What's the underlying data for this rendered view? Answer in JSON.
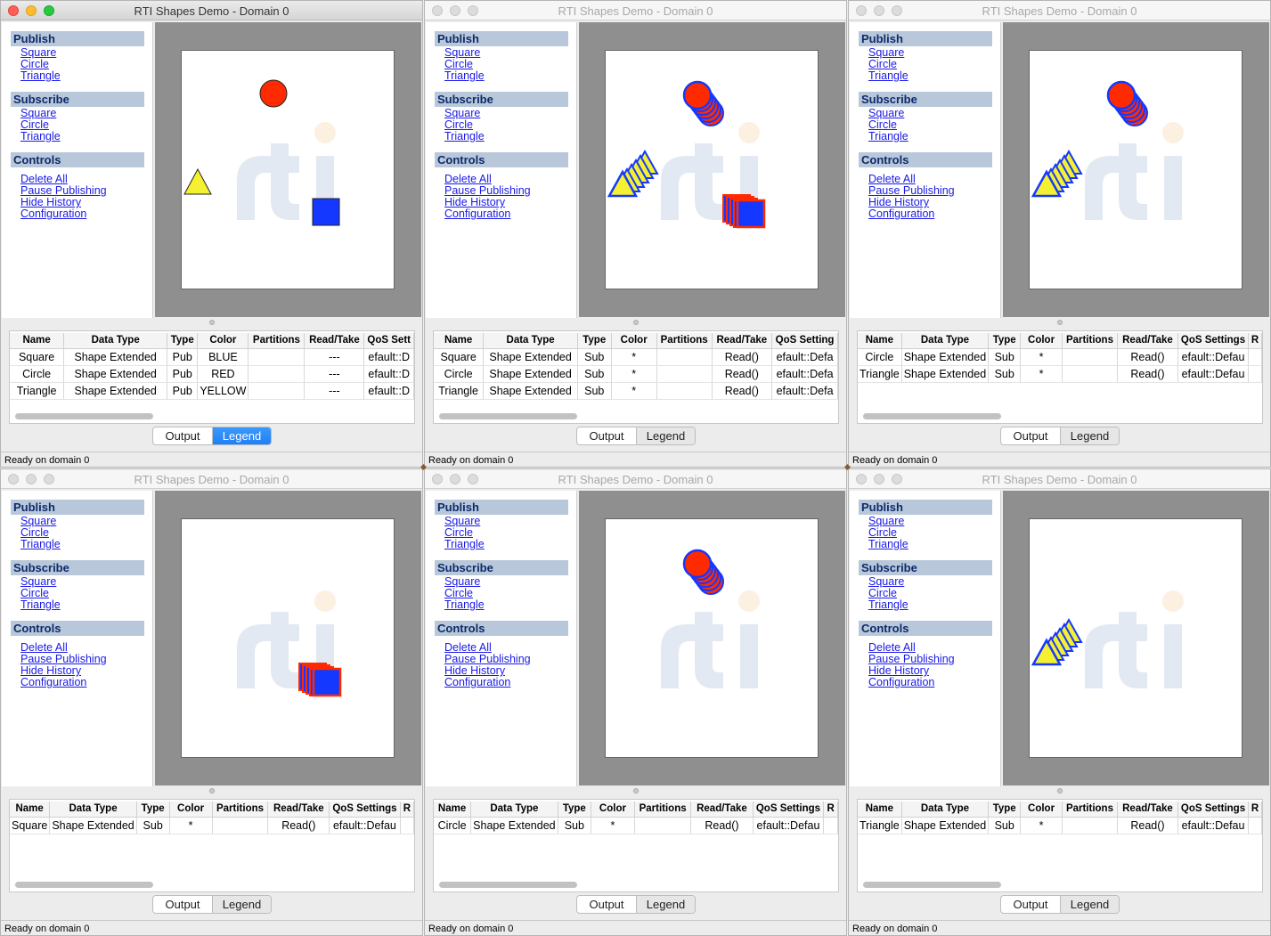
{
  "colors": {
    "accent": "#1f7ff7",
    "shape_red": "#ff2a00",
    "shape_blue": "#1438ff",
    "shape_yellow": "#f5f032",
    "section_header": "#b8c8da",
    "link": "#1a1ae6"
  },
  "windows": [
    {
      "title": "RTI Shapes Demo - Domain 0",
      "active": true,
      "sections": [
        {
          "label": "Publish",
          "links": [
            "Square",
            "Circle",
            "Triangle"
          ]
        },
        {
          "label": "Subscribe",
          "links": [
            "Square",
            "Circle",
            "Triangle"
          ]
        },
        {
          "label": "Controls",
          "links": [
            "Delete All",
            "Pause Publishing",
            "Hide History",
            "Configuration"
          ]
        }
      ],
      "table": {
        "columns": [
          "Name",
          "Data Type",
          "Type",
          "Color",
          "Partitions",
          "Read/Take",
          "QoS Sett"
        ],
        "rows": [
          [
            "Square",
            "Shape Extended",
            "Pub",
            "BLUE",
            "",
            "---",
            "efault::D"
          ],
          [
            "Circle",
            "Shape Extended",
            "Pub",
            "RED",
            "",
            "---",
            "efault::D"
          ],
          [
            "Triangle",
            "Shape Extended",
            "Pub",
            "YELLOW",
            "",
            "---",
            "efault::D"
          ]
        ]
      },
      "tabs": [
        "Output",
        "Legend"
      ],
      "selected_tab": "Legend",
      "status": "Ready on domain 0"
    },
    {
      "title": "RTI Shapes Demo - Domain 0",
      "active": false,
      "sections": [
        {
          "label": "Publish",
          "links": [
            "Square",
            "Circle",
            "Triangle"
          ]
        },
        {
          "label": "Subscribe",
          "links": [
            "Square",
            "Circle",
            "Triangle"
          ]
        },
        {
          "label": "Controls",
          "links": [
            "Delete All",
            "Pause Publishing",
            "Hide History",
            "Configuration"
          ]
        }
      ],
      "table": {
        "columns": [
          "Name",
          "Data Type",
          "Type",
          "Color",
          "Partitions",
          "Read/Take",
          "QoS Setting"
        ],
        "rows": [
          [
            "Square",
            "Shape Extended",
            "Sub",
            "*",
            "",
            "Read()",
            "efault::Defa"
          ],
          [
            "Circle",
            "Shape Extended",
            "Sub",
            "*",
            "",
            "Read()",
            "efault::Defa"
          ],
          [
            "Triangle",
            "Shape Extended",
            "Sub",
            "*",
            "",
            "Read()",
            "efault::Defa"
          ]
        ]
      },
      "tabs": [
        "Output",
        "Legend"
      ],
      "selected_tab": "",
      "status": "Ready on domain 0"
    },
    {
      "title": "RTI Shapes Demo - Domain 0",
      "active": false,
      "sections": [
        {
          "label": "Publish",
          "links": [
            "Square",
            "Circle",
            "Triangle"
          ]
        },
        {
          "label": "Subscribe",
          "links": [
            "Square",
            "Circle",
            "Triangle"
          ]
        },
        {
          "label": "Controls",
          "links": [
            "Delete All",
            "Pause Publishing",
            "Hide History",
            "Configuration"
          ]
        }
      ],
      "table": {
        "columns": [
          "Name",
          "Data Type",
          "Type",
          "Color",
          "Partitions",
          "Read/Take",
          "QoS Settings",
          "R"
        ],
        "rows": [
          [
            "Circle",
            "Shape Extended",
            "Sub",
            "*",
            "",
            "Read()",
            "efault::Defau",
            ""
          ],
          [
            "Triangle",
            "Shape Extended",
            "Sub",
            "*",
            "",
            "Read()",
            "efault::Defau",
            ""
          ]
        ]
      },
      "tabs": [
        "Output",
        "Legend"
      ],
      "selected_tab": "",
      "status": "Ready on domain 0"
    },
    {
      "title": "RTI Shapes Demo - Domain 0",
      "active": false,
      "sections": [
        {
          "label": "Publish",
          "links": [
            "Square",
            "Circle",
            "Triangle"
          ]
        },
        {
          "label": "Subscribe",
          "links": [
            "Square",
            "Circle",
            "Triangle"
          ]
        },
        {
          "label": "Controls",
          "links": [
            "Delete All",
            "Pause Publishing",
            "Hide History",
            "Configuration"
          ]
        }
      ],
      "table": {
        "columns": [
          "Name",
          "Data Type",
          "Type",
          "Color",
          "Partitions",
          "Read/Take",
          "QoS Settings",
          "R"
        ],
        "rows": [
          [
            "Square",
            "Shape Extended",
            "Sub",
            "*",
            "",
            "Read()",
            "efault::Defau",
            ""
          ]
        ]
      },
      "tabs": [
        "Output",
        "Legend"
      ],
      "selected_tab": "",
      "status": "Ready on domain 0"
    },
    {
      "title": "RTI Shapes Demo - Domain 0",
      "active": false,
      "sections": [
        {
          "label": "Publish",
          "links": [
            "Square",
            "Circle",
            "Triangle"
          ]
        },
        {
          "label": "Subscribe",
          "links": [
            "Square",
            "Circle",
            "Triangle"
          ]
        },
        {
          "label": "Controls",
          "links": [
            "Delete All",
            "Pause Publishing",
            "Hide History",
            "Configuration"
          ]
        }
      ],
      "table": {
        "columns": [
          "Name",
          "Data Type",
          "Type",
          "Color",
          "Partitions",
          "Read/Take",
          "QoS Settings",
          "R"
        ],
        "rows": [
          [
            "Circle",
            "Shape Extended",
            "Sub",
            "*",
            "",
            "Read()",
            "efault::Defau",
            ""
          ]
        ]
      },
      "tabs": [
        "Output",
        "Legend"
      ],
      "selected_tab": "",
      "status": "Ready on domain 0"
    },
    {
      "title": "RTI Shapes Demo - Domain 0",
      "active": false,
      "sections": [
        {
          "label": "Publish",
          "links": [
            "Square",
            "Circle",
            "Triangle"
          ]
        },
        {
          "label": "Subscribe",
          "links": [
            "Square",
            "Circle",
            "Triangle"
          ]
        },
        {
          "label": "Controls",
          "links": [
            "Delete All",
            "Pause Publishing",
            "Hide History",
            "Configuration"
          ]
        }
      ],
      "table": {
        "columns": [
          "Name",
          "Data Type",
          "Type",
          "Color",
          "Partitions",
          "Read/Take",
          "QoS Settings",
          "R"
        ],
        "rows": [
          [
            "Triangle",
            "Shape Extended",
            "Sub",
            "*",
            "",
            "Read()",
            "efault::Defau",
            ""
          ]
        ]
      },
      "tabs": [
        "Output",
        "Legend"
      ],
      "selected_tab": "",
      "status": "Ready on domain 0"
    }
  ]
}
